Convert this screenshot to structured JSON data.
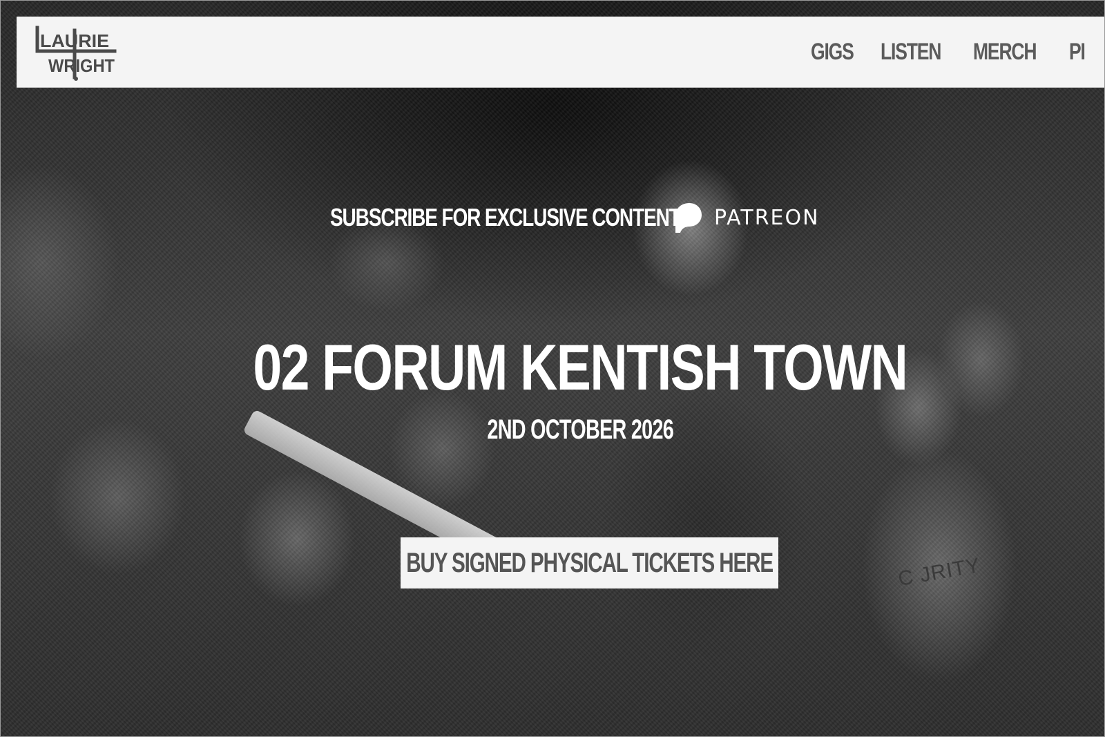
{
  "header": {
    "logo_alt": "LAURIE WRIGHT",
    "logo_lines": [
      "LAURIE",
      "WRIGHT"
    ],
    "nav": [
      {
        "label": "GIGS"
      },
      {
        "label": "LISTEN"
      },
      {
        "label": "MERCH"
      },
      {
        "label": "PI"
      }
    ]
  },
  "hero": {
    "subscribe_text": "SUBSCRIBE FOR EXCLUSIVE CONTENT",
    "patreon_label": "PATREON",
    "patreon_icon": "patreon-icon",
    "venue": "02 FORUM KENTISH TOWN",
    "date": "2ND OCTOBER 2026",
    "cta_label": "BUY SIGNED PHYSICAL TICKETS HERE",
    "background_text": "C JRITY"
  },
  "colors": {
    "header_bg": "#f4f4f4",
    "nav_text": "#5b5b5b",
    "hero_text": "#ffffff",
    "cta_bg": "#f4f4f4",
    "cta_text": "#555555"
  }
}
